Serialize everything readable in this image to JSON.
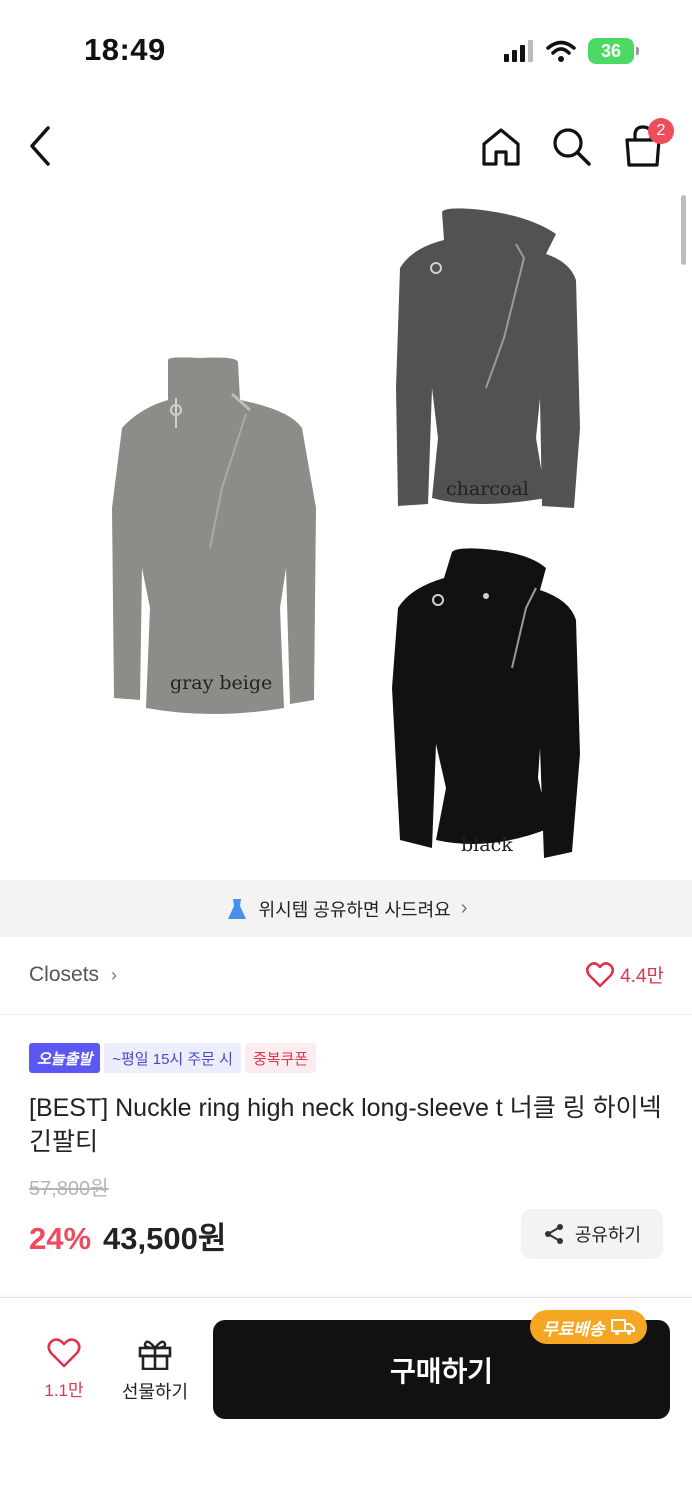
{
  "status_bar": {
    "time": "18:49",
    "battery": "36"
  },
  "nav": {
    "cart_count": "2"
  },
  "product_image": {
    "variants": [
      {
        "label": "gray beige",
        "color": "#8e8c89"
      },
      {
        "label": "charcoal",
        "color": "#525252"
      },
      {
        "label": "black",
        "color": "#111111"
      }
    ]
  },
  "wish_banner": {
    "text": "위시템 공유하면 사드려요"
  },
  "store": {
    "name": "Closets",
    "likes": "4.4만"
  },
  "product": {
    "badges": {
      "today": "오늘출발",
      "time": "~평일 15시 주문 시",
      "coupon": "중복쿠폰"
    },
    "title": "[BEST] Nuckle ring high neck long-sleeve t 너클 링 하이넥 긴팔티",
    "original_price": "57,800원",
    "discount": "24%",
    "price": "43,500원",
    "share_label": "공유하기"
  },
  "bottom_bar": {
    "wish_count": "1.1만",
    "gift_label": "선물하기",
    "buy_label": "구매하기",
    "free_shipping": "무료배송"
  },
  "colors": {
    "accent": "#ef4a5e",
    "badge_blue": "#5b57f2",
    "free_shipping": "#f5a623",
    "buy_button": "#111111"
  }
}
